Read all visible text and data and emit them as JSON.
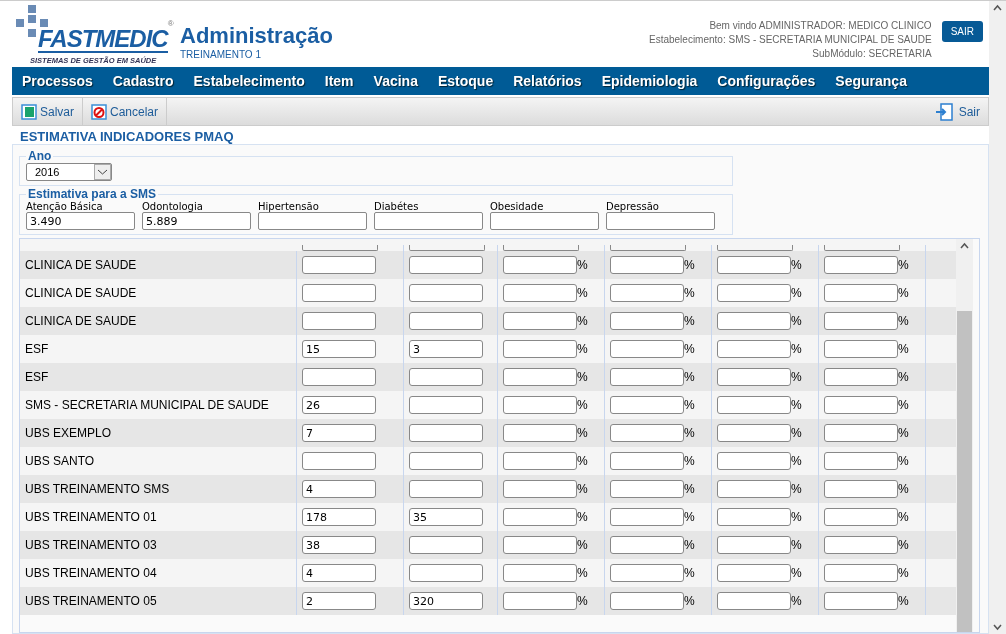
{
  "logo": {
    "brand": "FASTMEDIC",
    "tagline": "SISTEMAS DE GESTÃO EM SAÚDE",
    "mark": "®"
  },
  "header": {
    "title": "Administração",
    "subtitle": "TREINAMENTO 1",
    "user_lines": [
      "Bem vindo ADMINISTRADOR: MEDICO CLINICO",
      "Estabelecimento: SMS - SECRETARIA MUNICIPAL DE SAUDE",
      "SubMódulo: SECRETARIA"
    ],
    "logout": "SAIR"
  },
  "menu": [
    "Processos",
    "Cadastro",
    "Estabelecimento",
    "Item",
    "Vacina",
    "Estoque",
    "Relatórios",
    "Epidemiologia",
    "Configurações",
    "Segurança"
  ],
  "toolbar": {
    "save": "Salvar",
    "cancel": "Cancelar",
    "exit": "Sair"
  },
  "page_title": "ESTIMATIVA INDICADORES PMAQ",
  "year": {
    "legend": "Ano",
    "value": "2016"
  },
  "estimate": {
    "legend": "Estimativa para a SMS",
    "fields": [
      {
        "label": "Atenção Básica",
        "value": "3.490"
      },
      {
        "label": "Odontologia",
        "value": "5.889"
      },
      {
        "label": "Hipertensão"
      },
      {
        "label": "Diabétes"
      },
      {
        "label": "Obesidade"
      },
      {
        "label": "Depressão"
      }
    ]
  },
  "rows": [
    {
      "name": "CLINICA DE SAUDE",
      "values": []
    },
    {
      "name": "CLINICA DE SAUDE",
      "values": []
    },
    {
      "name": "CLINICA DE SAUDE",
      "values": []
    },
    {
      "name": "ESF",
      "values": [
        "15",
        "3"
      ]
    },
    {
      "name": "ESF",
      "values": []
    },
    {
      "name": "SMS - SECRETARIA MUNICIPAL DE SAUDE",
      "values": [
        "26"
      ]
    },
    {
      "name": "UBS EXEMPLO",
      "values": [
        "7"
      ]
    },
    {
      "name": "UBS SANTO",
      "values": []
    },
    {
      "name": "UBS TREINAMENTO SMS",
      "values": [
        "4"
      ]
    },
    {
      "name": "UBS TREINAMENTO 01",
      "values": [
        "178",
        "35"
      ]
    },
    {
      "name": "UBS TREINAMENTO 03",
      "values": [
        "38"
      ]
    },
    {
      "name": "UBS TREINAMENTO 04",
      "values": [
        "4"
      ]
    },
    {
      "name": "UBS TREINAMENTO 05",
      "values": [
        "2",
        "320"
      ]
    }
  ],
  "percent_sign": "%"
}
